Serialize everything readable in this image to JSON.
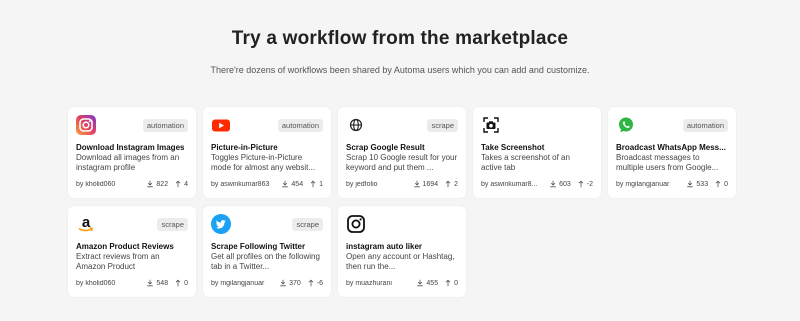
{
  "header": {
    "title": "Try a workflow from the marketplace",
    "subtitle": "There're dozens of workflows been shared by Automa users which you can add and customize."
  },
  "workflows": [
    {
      "icon": "instagram-icon",
      "category": "automation",
      "name": "Download Instagram Images",
      "description": "Download all images from an instagram profile",
      "author": "by kholid060",
      "downloads": "822",
      "upvotes": "4"
    },
    {
      "icon": "youtube-icon",
      "category": "automation",
      "name": "Picture-in-Picture",
      "description": "Toggles Picture-in-Picture mode for almost any websit...",
      "author": "by aswinkumar863",
      "downloads": "454",
      "upvotes": "1"
    },
    {
      "icon": "globe-icon",
      "category": "scrape",
      "name": "Scrap Google Result",
      "description": "Scrap 10 Google result for your keyword and put them ...",
      "author": "by jedfolio",
      "downloads": "1694",
      "upvotes": "2"
    },
    {
      "icon": "screenshot-icon",
      "category": "",
      "name": "Take Screenshot",
      "description": "Takes a screenshot of an active tab",
      "author": "by aswinkumar8...",
      "downloads": "603",
      "upvotes": "-2"
    },
    {
      "icon": "whatsapp-icon",
      "category": "automation",
      "name": "Broadcast WhatsApp Mess...",
      "description": "Broadcast messages to multiple users from Google...",
      "author": "by mgilangjanuar",
      "downloads": "533",
      "upvotes": "0"
    },
    {
      "icon": "amazon-icon",
      "category": "scrape",
      "name": "Amazon Product Reviews",
      "description": "Extract reviews from an Amazon Product",
      "author": "by kholid060",
      "downloads": "548",
      "upvotes": "0"
    },
    {
      "icon": "twitter-icon",
      "category": "scrape",
      "name": "Scrape Following Twitter",
      "description": "Get all profiles on the following tab in a Twitter...",
      "author": "by mgilangjanuar",
      "downloads": "370",
      "upvotes": "-6"
    },
    {
      "icon": "instagram-outline-icon",
      "category": "",
      "name": "instagram auto liker",
      "description": "Open any account or Hashtag, then run the...",
      "author": "by muazhurani",
      "downloads": "455",
      "upvotes": "0"
    }
  ]
}
